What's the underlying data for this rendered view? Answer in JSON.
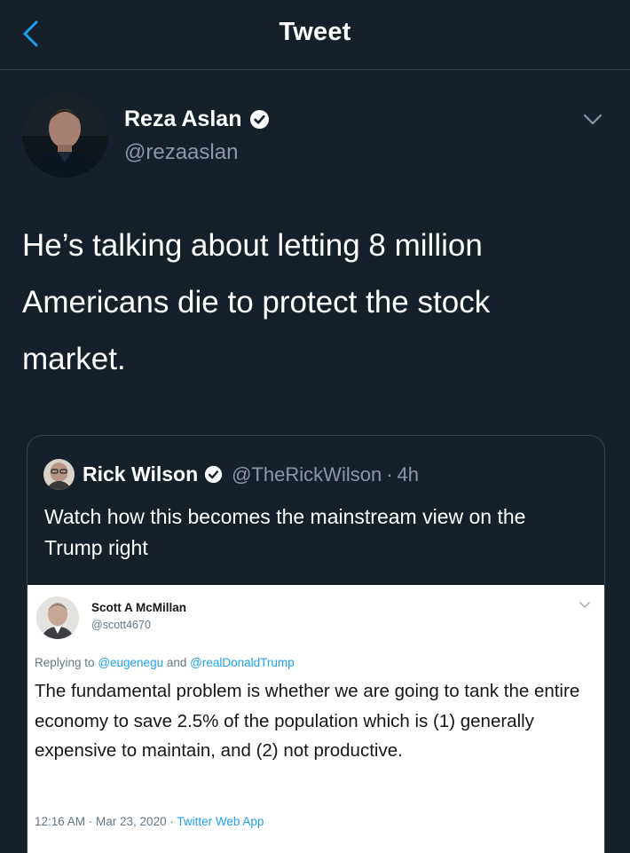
{
  "header": {
    "title": "Tweet",
    "back_icon": "chevron-left-icon"
  },
  "tweet": {
    "author": {
      "name": "Reza Aslan",
      "handle": "@rezaaslan",
      "verified": true
    },
    "text": "He’s talking about letting 8 million Americans die to protect the stock market."
  },
  "quoted_tweet": {
    "author": {
      "name": "Rick Wilson",
      "handle": "@TheRickWilson",
      "verified": true
    },
    "separator": "·",
    "time": "4h",
    "text": "Watch how this becomes the mainstream view on the Trump right",
    "embedded_screenshot": {
      "author": {
        "name": "Scott A McMillan",
        "handle": "@scott4670"
      },
      "replying_prefix": "Replying to",
      "mentions": [
        "@eugenegu",
        "@realDonaldTrump"
      ],
      "mention_joiner": "and",
      "text": "The fundamental problem is whether we are going to tank the entire economy to save 2.5% of the population which is (1) generally expensive to maintain, and (2) not productive.",
      "timestamp": "12:16 AM · Mar 23, 2020 ·",
      "source": "Twitter Web App"
    }
  },
  "colors": {
    "background": "#15202b",
    "accent": "#1da1f2",
    "secondary_text": "#8899a6",
    "border": "#38444d"
  }
}
